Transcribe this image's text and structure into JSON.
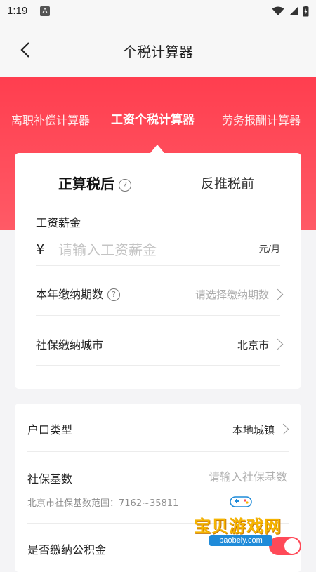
{
  "status_bar": {
    "time": "1:19",
    "notification_icon": "A"
  },
  "appbar": {
    "title": "个税计算器"
  },
  "calculator_tabs": [
    {
      "label": "离职补偿计算器"
    },
    {
      "label": "工资个税计算器"
    },
    {
      "label": "劳务报酬计算器"
    }
  ],
  "active_calculator_tab": 1,
  "modes": {
    "forward": "正算税后",
    "reverse": "反推税前",
    "help_glyph": "?"
  },
  "salary": {
    "label": "工资薪金",
    "currency": "¥",
    "placeholder": "请输入工资薪金",
    "value": "",
    "unit": "元/月"
  },
  "periods": {
    "label": "本年缴纳期数",
    "placeholder": "请选择缴纳期数"
  },
  "social_city": {
    "label": "社保缴纳城市",
    "value": "北京市"
  },
  "hukou": {
    "label": "户口类型",
    "value": "本地城镇"
  },
  "social_base": {
    "label": "社保基数",
    "placeholder": "请输入社保基数",
    "range_hint": "北京市社保基数范围：7162~35811"
  },
  "housing_fund": {
    "label": "是否缴纳公积金",
    "enabled": true
  },
  "watermark": {
    "text": "宝贝游戏网",
    "url": "baobeiy.com"
  },
  "colors": {
    "accent": "#ff4a58",
    "banner": "#ff3e4f",
    "watermark": "#f5b400"
  }
}
